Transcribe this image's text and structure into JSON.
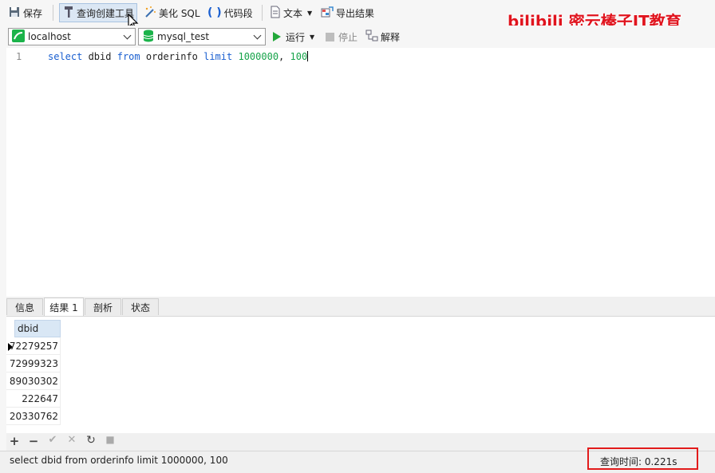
{
  "toolbar": {
    "save": "保存",
    "query_builder": "查询创建工具",
    "beautify_sql": "美化 SQL",
    "code_snippet": "代码段",
    "text": "文本",
    "export_results": "导出结果",
    "run": "运行",
    "stop": "停止",
    "explain": "解释"
  },
  "connection": {
    "value": "localhost"
  },
  "database": {
    "value": "mysql_test"
  },
  "brand": "bilibili 密云榛子IT教育",
  "editor": {
    "line_number": "1",
    "tokens": {
      "t1": "select",
      "t2": " dbid ",
      "t3": "from",
      "t4": " orderinfo ",
      "t5": "limit",
      "t6": " ",
      "t7": "1000000",
      "t8": ", ",
      "t9": "100"
    }
  },
  "tabs": [
    "信息",
    "结果 1",
    "剖析",
    "状态"
  ],
  "result": {
    "column": "dbid",
    "rows": [
      "72279257",
      "72999323",
      "89030302",
      "222647",
      "20330762"
    ]
  },
  "bottom_tools": {
    "add": "+",
    "remove": "−",
    "apply": "✔",
    "discard": "✕",
    "refresh": "↻",
    "stop": "■"
  },
  "status": {
    "sql": "select dbid from orderinfo limit 1000000, 100",
    "query_time": "查询时间: 0.221s"
  },
  "colors": {
    "highlight_box": "#e21b1b",
    "brand": "#e0141e",
    "keyword": "#1a5fd0",
    "number": "#17a34a"
  }
}
